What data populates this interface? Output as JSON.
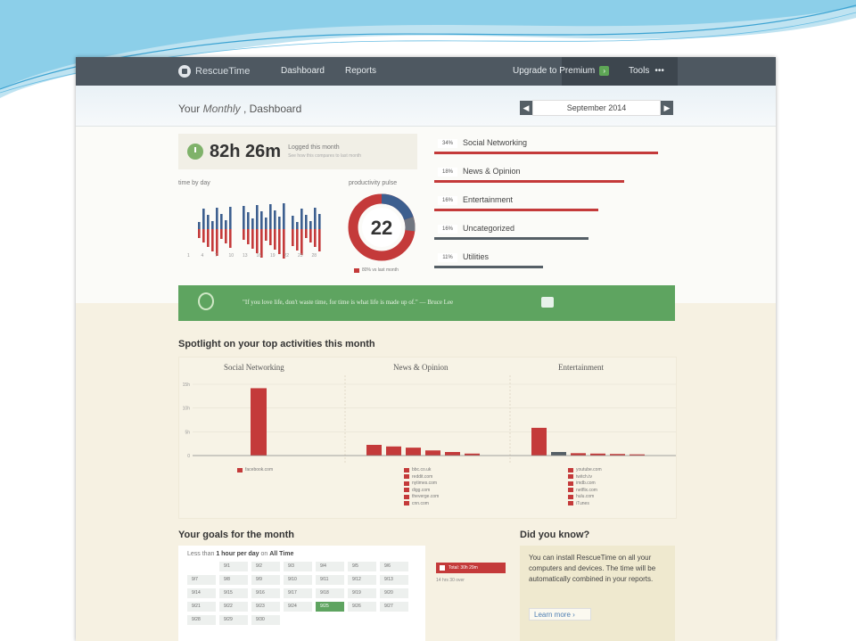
{
  "colors": {
    "nav_bg": "#4e5861",
    "accent_red": "#c43a3a",
    "accent_green": "#5ea460",
    "slide_blue": "#5bb4dc"
  },
  "nav": {
    "logo_text": "RescueTime",
    "links": [
      "Dashboard",
      "Reports"
    ],
    "upgrade_label": "Upgrade to Premium",
    "tools_label": "Tools",
    "tools_more": "•••"
  },
  "header": {
    "prefix": "Your",
    "period_select": "Monthly",
    "suffix": "Dashboard",
    "month": "September 2014",
    "prev_icon": "chevron-left-icon",
    "next_icon": "chevron-right-icon"
  },
  "logged": {
    "value": "82h 26m",
    "label": "Logged this month",
    "sublabel": "See how this compares to last month"
  },
  "time_by_day_label": "time by day",
  "productivity": {
    "label": "productivity pulse",
    "score": "22",
    "legend": "80% vs last month"
  },
  "day_ticks": [
    "1",
    "4",
    "7",
    "10",
    "13",
    "16",
    "19",
    "22",
    "25",
    "28"
  ],
  "categories": [
    {
      "pct": "34%",
      "name": "Social Networking",
      "fill": 0.93,
      "color": "#c43a3a"
    },
    {
      "pct": "18%",
      "name": "News & Opinion",
      "fill": 0.79,
      "color": "#c43a3a"
    },
    {
      "pct": "16%",
      "name": "Entertainment",
      "fill": 0.68,
      "color": "#c43a3a"
    },
    {
      "pct": "16%",
      "name": "Uncategorized",
      "fill": 0.64,
      "color": "#555f66"
    },
    {
      "pct": "11%",
      "name": "Utilities",
      "fill": 0.45,
      "color": "#555f66"
    }
  ],
  "quote": {
    "text": "\"If you love life, don't waste time, for time is what life is made up of.\" — Bruce Lee",
    "icon": "pulse-icon",
    "share_icon": "share-icon"
  },
  "spotlight": {
    "title": "Spotlight on your top activities this month",
    "headers": [
      "Social Networking",
      "News & Opinion",
      "Entertainment"
    ],
    "y_ticks": [
      "15h",
      "10h",
      "5h",
      "0"
    ],
    "legend_social": [
      "facebook.com"
    ],
    "legend_news": [
      "bbc.co.uk",
      "reddit.com",
      "nytimes.com",
      "digg.com",
      "theverge.com",
      "cnn.com"
    ],
    "legend_ent": [
      "youtube.com",
      "twitch.tv",
      "imdb.com",
      "netflix.com",
      "hulu.com",
      "iTunes"
    ]
  },
  "chart_data": [
    {
      "type": "bar",
      "title": "Social Networking",
      "categories": [
        "facebook.com"
      ],
      "values": [
        17
      ],
      "ylim": [
        0,
        18
      ]
    },
    {
      "type": "bar",
      "title": "News & Opinion",
      "categories": [
        "1",
        "2",
        "3",
        "4",
        "5",
        "6"
      ],
      "values": [
        2.7,
        2.3,
        2.0,
        1.3,
        0.9,
        0.5
      ],
      "ylim": [
        0,
        18
      ]
    },
    {
      "type": "bar",
      "title": "Entertainment",
      "categories": [
        "1",
        "2",
        "3",
        "4",
        "5",
        "6"
      ],
      "values": [
        7,
        0.9,
        0.6,
        0.5,
        0.4,
        0.3
      ],
      "ylim": [
        0,
        18
      ]
    }
  ],
  "goals": {
    "title": "Your goals for the month",
    "subtitle_prefix": "Less than",
    "subtitle_value": "1 hour per day",
    "subtitle_mid": "on",
    "subtitle_target": "All Time",
    "days": [
      "9/1",
      "9/2",
      "9/3",
      "9/4",
      "9/5",
      "9/6",
      "9/7",
      "9/8",
      "9/9",
      "9/10",
      "9/11",
      "9/12",
      "9/13",
      "9/14",
      "9/15",
      "9/16",
      "9/17",
      "9/18",
      "9/19",
      "9/20",
      "9/21",
      "9/22",
      "9/23",
      "9/24",
      "9/25",
      "9/26",
      "9/27",
      "9/28",
      "9/29",
      "9/30"
    ],
    "highlight_day": "9/25",
    "total_label": "Total: 30h 29m",
    "note": "14 hrs 30 over"
  },
  "did_you_know": {
    "title": "Did you know?",
    "text": "You can install RescueTime on all your computers and devices. The time will be automatically combined in your reports.",
    "button": "Learn more"
  }
}
